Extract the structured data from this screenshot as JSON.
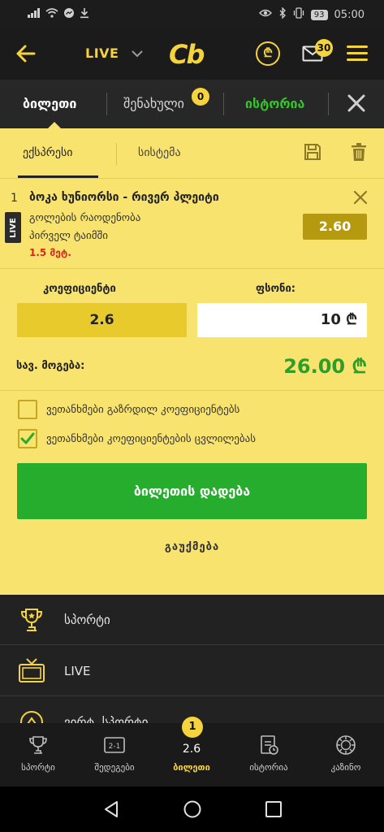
{
  "statusbar": {
    "battery": "93",
    "time": "05:00"
  },
  "appbar": {
    "live_label": "LIVE",
    "logo": "Cb",
    "coin_symbol": "₾",
    "mail_count": "30"
  },
  "tabs": {
    "ticket": "ბილეთი",
    "saved": "შენახული",
    "saved_count": "0",
    "history": "ისტორია"
  },
  "subtabs": {
    "express": "ექსპრესი",
    "system": "სისტემა"
  },
  "event": {
    "number": "1",
    "live": "LIVE",
    "title": "ბოკა ხუნიორსი - რივერ პლეიტი",
    "market": "გოლების რაოდენობა",
    "period": "პირველ ტაიმში",
    "selection": "1.5 მეტ.",
    "odd": "2.60"
  },
  "bet": {
    "coef_label": "კოეფიციენტი",
    "coef_value": "2.6",
    "stake_label": "ფსონი:",
    "stake_value": "10 ₾",
    "win_label": "სავ. მოგება:",
    "win_value": "26.00 ₾"
  },
  "options": {
    "agree_increased": "ვეთანხმები გაზრდილ კოეფიციენტებს",
    "agree_increased_checked": false,
    "agree_changed": "ვეთანხმები კოეფიციენტების ცვლილებას",
    "agree_changed_checked": true
  },
  "actions": {
    "place": "ბილეთის დადება",
    "cancel": "გაუქმება"
  },
  "menu": {
    "sport": "სპორტი",
    "live": "LIVE",
    "virtual": "ვირტ. სპორტი"
  },
  "bottomnav": {
    "sport": "სპორტი",
    "results": "შედეგები",
    "ticket": "ბილეთი",
    "ticket_count": "1",
    "ticket_odd": "2.6",
    "history": "ისტორია",
    "casino": "კაზინო"
  },
  "colors": {
    "brand_yellow": "#f5d33d",
    "panel_yellow": "#f8e36f",
    "green": "#27ad2e",
    "red": "#d7261f",
    "odd_gold": "#b59a10"
  }
}
